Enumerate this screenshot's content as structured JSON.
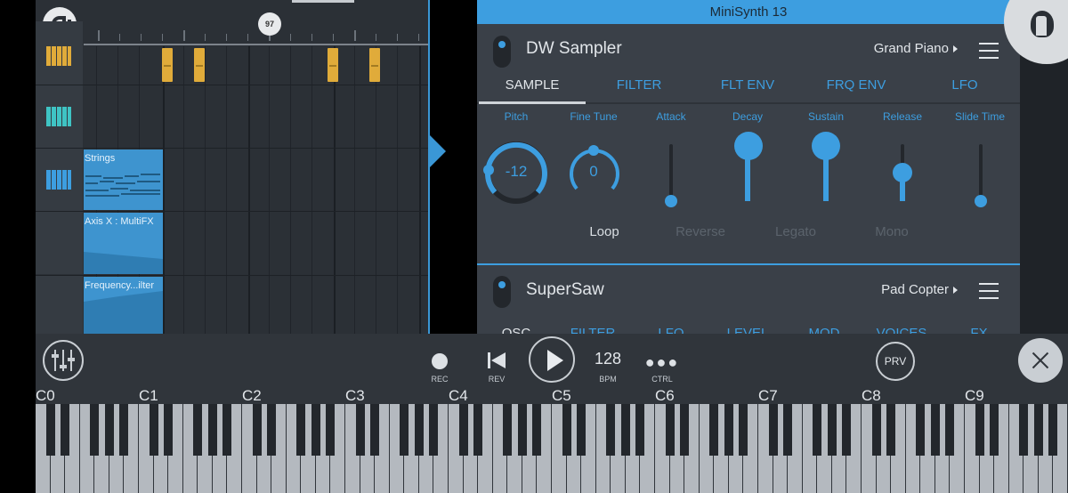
{
  "sequencer": {
    "position_marker": "97",
    "clips": [
      {
        "name": "Strings"
      },
      {
        "name": "Axis X : MultiFX"
      },
      {
        "name": "Frequency...ilter"
      }
    ]
  },
  "panel": {
    "title": "MiniSynth 13",
    "module1": {
      "name": "DW Sampler",
      "preset": "Grand Piano",
      "tabs": [
        "SAMPLE",
        "FILTER",
        "FLT ENV",
        "FRQ ENV",
        "LFO"
      ],
      "active_tab": "SAMPLE",
      "params": {
        "pitch": {
          "label": "Pitch",
          "value": "-12"
        },
        "fine_tune": {
          "label": "Fine Tune",
          "value": "0"
        },
        "attack": {
          "label": "Attack",
          "level": 0.0
        },
        "decay": {
          "label": "Decay",
          "level": 1.0
        },
        "sustain": {
          "label": "Sustain",
          "level": 1.0
        },
        "release": {
          "label": "Release",
          "level": 0.5
        },
        "slide_time": {
          "label": "Slide Time",
          "level": 0.0
        }
      },
      "options": [
        {
          "label": "Loop",
          "on": true
        },
        {
          "label": "Reverse",
          "on": false
        },
        {
          "label": "Legato",
          "on": false
        },
        {
          "label": "Mono",
          "on": false
        }
      ]
    },
    "module2": {
      "name": "SuperSaw",
      "preset": "Pad Copter",
      "tabs": [
        "OSC",
        "FILTER",
        "LFO",
        "LEVEL",
        "MOD",
        "VOICES",
        "FX"
      ]
    }
  },
  "transport": {
    "rec_label": "REC",
    "rev_label": "REV",
    "bpm_value": "128",
    "bpm_label": "BPM",
    "ctrl_label": "CTRL",
    "prv_label": "PRV"
  },
  "keyboard": {
    "octaves": [
      "C0",
      "C1",
      "C2",
      "C3",
      "C4",
      "C5",
      "C6",
      "C7",
      "C8",
      "C9"
    ]
  },
  "colors": {
    "accent": "#3d9ee0",
    "note": "#e0ab3a",
    "panel_bg": "#3a4048",
    "teal": "#3fc4c4"
  }
}
